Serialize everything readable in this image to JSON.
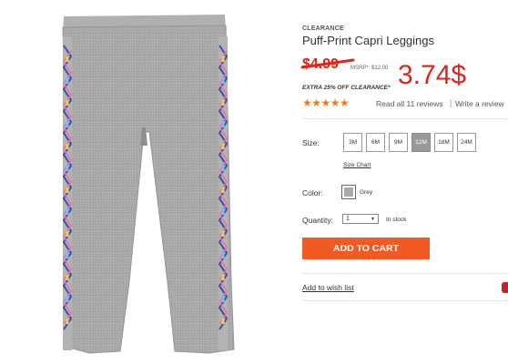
{
  "product": {
    "badge": "CLEARANCE",
    "title": "Puff-Print Capri Leggings",
    "old_price": "$4.99",
    "msrp": "MSRP*: $12.00",
    "new_price": "3.74$",
    "promo": "EXTRA 25% OFF CLEARANCE*",
    "rating_stars": "★★★★★",
    "rating": 5,
    "reviews_link": "Read all 11 reviews",
    "separator": "|",
    "write_review": "Write a review"
  },
  "size": {
    "label": "Size:",
    "options": [
      "3M",
      "6M",
      "9M",
      "12M",
      "18M",
      "24M"
    ],
    "selected": "12M",
    "chart_link": "Size Chart"
  },
  "color": {
    "label": "Color:",
    "name": "Grey",
    "swatch": "#a9a9a9"
  },
  "quantity": {
    "label": "Quantity:",
    "value": "1",
    "stock": "In stock"
  },
  "actions": {
    "add_to_cart": "ADD TO CART",
    "wishlist": "Add to wish list"
  },
  "colors": {
    "accent": "#f15a22",
    "price_red": "#e2231a",
    "star": "#f27a1a",
    "leggings_grey": "#a8a8a8",
    "pinterest": "#cb2027"
  },
  "icons": {
    "share": "pinterest-icon",
    "dropdown": "chevron-down-icon"
  }
}
